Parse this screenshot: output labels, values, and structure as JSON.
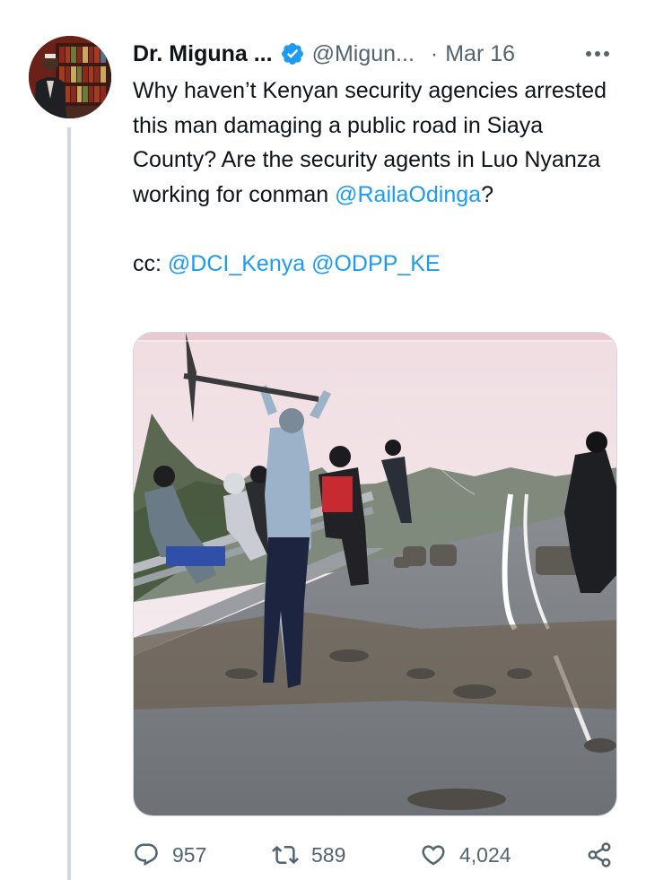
{
  "author": {
    "display_name": "Dr. Miguna ...",
    "handle": "@Migun...",
    "separator": "·",
    "date": "Mar 16",
    "verified": true
  },
  "tweet": {
    "text_main": "Why haven’t Kenyan security agencies arrested this man damaging a public road in Siaya County? Are the security agents in Luo Nyanza working for conman ",
    "mention_inline": "@RailaOdinga",
    "text_after_mention": "?",
    "cc_label": "cc: ",
    "cc_mention_1": "@DCI_Kenya",
    "cc_space": " ",
    "cc_mention_2": "@ODPP_KE"
  },
  "actions": {
    "replies": "957",
    "retweets": "589",
    "likes": "4,024"
  },
  "colors": {
    "link": "#1d9bf0",
    "secondary_text": "#536471",
    "thread_line": "#cfd9de",
    "verified_badge": "#1d9bf0"
  },
  "icons": {
    "more": "more-dots-icon",
    "reply": "reply-icon",
    "retweet": "retweet-icon",
    "like": "heart-icon",
    "share": "share-icon",
    "verified": "verified-badge-icon"
  }
}
